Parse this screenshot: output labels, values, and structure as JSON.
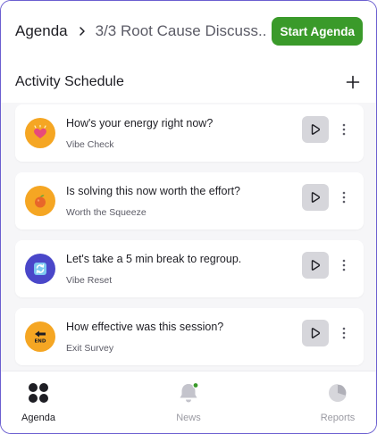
{
  "header": {
    "breadcrumb_root": "Agenda",
    "breadcrumb_current": "3/3 Root Cause Discuss..",
    "start_button": "Start Agenda"
  },
  "section": {
    "title": "Activity Schedule"
  },
  "activities": [
    {
      "title": "How's your energy right now?",
      "subtitle": "Vibe Check",
      "icon": "heart-icon",
      "color": "#f5a623"
    },
    {
      "title": "Is solving this now worth the effort?",
      "subtitle": "Worth the Squeeze",
      "icon": "orange-fruit-icon",
      "color": "#f5a623"
    },
    {
      "title": "Let's take a 5 min break to regroup.",
      "subtitle": "Vibe Reset",
      "icon": "refresh-icon",
      "color": "#4a47c9"
    },
    {
      "title": "How effective was this session?",
      "subtitle": "Exit Survey",
      "icon": "end-arrow-icon",
      "icon_text": "END",
      "color": "#f5a623"
    }
  ],
  "nav": {
    "items": [
      {
        "label": "Agenda",
        "icon": "grid-dots-icon",
        "active": true
      },
      {
        "label": "News",
        "icon": "bell-icon",
        "active": false
      },
      {
        "label": "Reports",
        "icon": "pie-chart-icon",
        "active": false
      }
    ]
  },
  "colors": {
    "accent": "#3a9a2a",
    "frame": "#6b5fd0"
  }
}
